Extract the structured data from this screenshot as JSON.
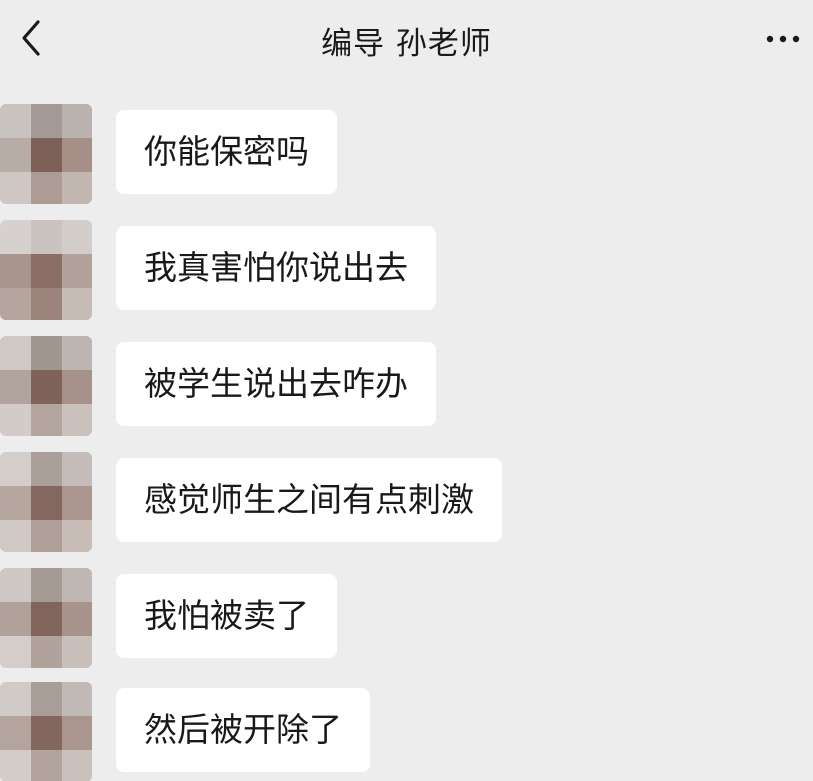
{
  "header": {
    "back_icon": "chevron-left-icon",
    "title": "编导 孙老师",
    "more_icon": "more-dots-icon"
  },
  "messages": [
    {
      "text": "你能保密吗"
    },
    {
      "text": "我真害怕你说出去"
    },
    {
      "text": "被学生说出去咋办"
    },
    {
      "text": "感觉师生之间有点刺激"
    },
    {
      "text": "我怕被卖了"
    },
    {
      "text": "然后被开除了"
    }
  ],
  "colors": {
    "background": "#ededed",
    "bubble": "#ffffff",
    "text": "#191919"
  }
}
